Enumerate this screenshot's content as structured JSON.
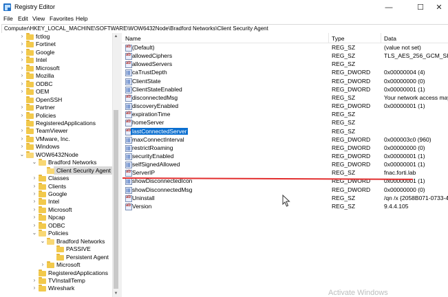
{
  "window": {
    "title": "Registry Editor",
    "minimize_glyph": "—",
    "maximize_glyph": "☐",
    "close_glyph": "✕"
  },
  "menu": [
    "File",
    "Edit",
    "View",
    "Favorites",
    "Help"
  ],
  "address": "Computer\\HKEY_LOCAL_MACHINE\\SOFTWARE\\WOW6432Node\\Bradford Networks\\Client Security Agent",
  "tree": [
    {
      "label": "fctlog",
      "depth": 0,
      "chevron": "›"
    },
    {
      "label": "Fortinet",
      "depth": 0,
      "chevron": "›"
    },
    {
      "label": "Google",
      "depth": 0,
      "chevron": "›"
    },
    {
      "label": "Intel",
      "depth": 0,
      "chevron": "›"
    },
    {
      "label": "Microsoft",
      "depth": 0,
      "chevron": "›"
    },
    {
      "label": "Mozilla",
      "depth": 0,
      "chevron": "›"
    },
    {
      "label": "ODBC",
      "depth": 0,
      "chevron": "›"
    },
    {
      "label": "OEM",
      "depth": 0,
      "chevron": "›"
    },
    {
      "label": "OpenSSH",
      "depth": 0,
      "chevron": ""
    },
    {
      "label": "Partner",
      "depth": 0,
      "chevron": "›"
    },
    {
      "label": "Policies",
      "depth": 0,
      "chevron": "›"
    },
    {
      "label": "RegisteredApplications",
      "depth": 0,
      "chevron": ""
    },
    {
      "label": "TeamViewer",
      "depth": 0,
      "chevron": "›"
    },
    {
      "label": "VMware, Inc.",
      "depth": 0,
      "chevron": "›"
    },
    {
      "label": "Windows",
      "depth": 0,
      "chevron": "›"
    },
    {
      "label": "WOW6432Node",
      "depth": 0,
      "chevron": "⌄",
      "open": true
    },
    {
      "label": "Bradford Networks",
      "depth": 1,
      "chevron": "⌄",
      "open": true
    },
    {
      "label": "Client Security Agent",
      "depth": 2,
      "chevron": "",
      "open": true,
      "selected": true
    },
    {
      "label": "Classes",
      "depth": 1,
      "chevron": "›"
    },
    {
      "label": "Clients",
      "depth": 1,
      "chevron": "›"
    },
    {
      "label": "Google",
      "depth": 1,
      "chevron": "›"
    },
    {
      "label": "Intel",
      "depth": 1,
      "chevron": "›"
    },
    {
      "label": "Microsoft",
      "depth": 1,
      "chevron": "›"
    },
    {
      "label": "Npcap",
      "depth": 1,
      "chevron": "›"
    },
    {
      "label": "ODBC",
      "depth": 1,
      "chevron": "›"
    },
    {
      "label": "Policies",
      "depth": 1,
      "chevron": "⌄",
      "open": true
    },
    {
      "label": "Bradford Networks",
      "depth": 2,
      "chevron": "⌄",
      "open": true
    },
    {
      "label": "PASSIVE",
      "depth": 3,
      "chevron": ""
    },
    {
      "label": "Persistent Agent",
      "depth": 3,
      "chevron": ""
    },
    {
      "label": "Microsoft",
      "depth": 2,
      "chevron": "›"
    },
    {
      "label": "RegisteredApplications",
      "depth": 1,
      "chevron": ""
    },
    {
      "label": "TVInstallTemp",
      "depth": 1,
      "chevron": "›"
    },
    {
      "label": "Wireshark",
      "depth": 1,
      "chevron": "›"
    }
  ],
  "columns": {
    "name": "Name",
    "type": "Type",
    "data": "Data"
  },
  "values": [
    {
      "icon": "string-value-icon",
      "name": "(Default)",
      "type": "REG_SZ",
      "data": "(value not set)"
    },
    {
      "icon": "string-value-icon",
      "name": "allowedCiphers",
      "type": "REG_SZ",
      "data": "TLS_AES_256_GCM_SHA384,"
    },
    {
      "icon": "string-value-icon",
      "name": "allowedServers",
      "type": "REG_SZ",
      "data": ""
    },
    {
      "icon": "dword-value-icon",
      "name": "caTrustDepth",
      "type": "REG_DWORD",
      "data": "0x00000004 (4)"
    },
    {
      "icon": "dword-value-icon",
      "name": "ClientState",
      "type": "REG_DWORD",
      "data": "0x00000000 (0)"
    },
    {
      "icon": "dword-value-icon",
      "name": "ClientStateEnabled",
      "type": "REG_DWORD",
      "data": "0x00000001 (1)"
    },
    {
      "icon": "string-value-icon",
      "name": "disconnectedMsg",
      "type": "REG_SZ",
      "data": "Your network access may be"
    },
    {
      "icon": "dword-value-icon",
      "name": "discoveryEnabled",
      "type": "REG_DWORD",
      "data": "0x00000001 (1)"
    },
    {
      "icon": "string-value-icon",
      "name": "expirationTime",
      "type": "REG_SZ",
      "data": ""
    },
    {
      "icon": "string-value-icon",
      "name": "homeServer",
      "type": "REG_SZ",
      "data": ""
    },
    {
      "icon": "string-value-icon",
      "name": "lastConnectedServer",
      "type": "REG_SZ",
      "data": "",
      "selected": true
    },
    {
      "icon": "dword-value-icon",
      "name": "maxConnectInterval",
      "type": "REG_DWORD",
      "data": "0x000003c0 (960)"
    },
    {
      "icon": "dword-value-icon",
      "name": "restrictRoaming",
      "type": "REG_DWORD",
      "data": "0x00000000 (0)"
    },
    {
      "icon": "dword-value-icon",
      "name": "securityEnabled",
      "type": "REG_DWORD",
      "data": "0x00000001 (1)"
    },
    {
      "icon": "dword-value-icon",
      "name": "selfSignedAllowed",
      "type": "REG_DWORD",
      "data": "0x00000001 (1)"
    },
    {
      "icon": "string-value-icon",
      "name": "ServerIP",
      "type": "REG_SZ",
      "data": "fnac.forti.lab"
    },
    {
      "icon": "dword-value-icon",
      "name": "showDisconnectedIcon",
      "type": "REG_DWORD",
      "data": "0x00000001 (1)"
    },
    {
      "icon": "dword-value-icon",
      "name": "showDisconnectedMsg",
      "type": "REG_DWORD",
      "data": "0x00000000 (0)"
    },
    {
      "icon": "string-value-icon",
      "name": "Uninstall",
      "type": "REG_SZ",
      "data": "/qn /x {2058B071-0733-4C17"
    },
    {
      "icon": "string-value-icon",
      "name": "Version",
      "type": "REG_SZ",
      "data": "9.4.4.105"
    }
  ],
  "watermark": "Activate Windows"
}
